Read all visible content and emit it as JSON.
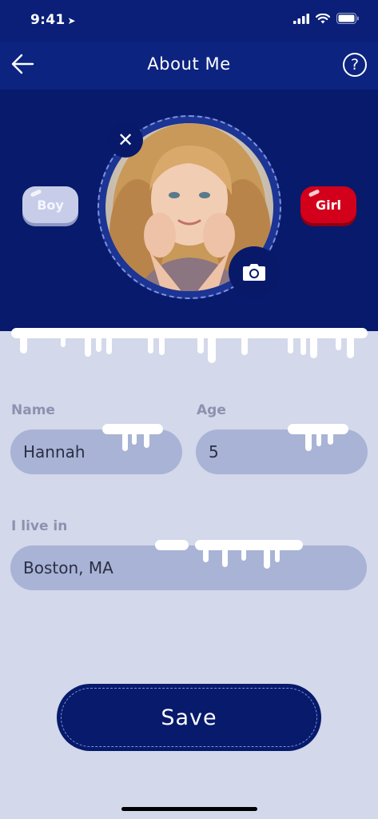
{
  "status_bar": {
    "time": "9:41"
  },
  "nav": {
    "title": "About Me",
    "help_label": "?"
  },
  "profile": {
    "boy_label": "Boy",
    "girl_label": "Girl",
    "selected_gender": "Girl"
  },
  "form": {
    "name_label": "Name",
    "name_value": "Hannah",
    "age_label": "Age",
    "age_value": "5",
    "location_label": "I live in",
    "location_value": "Boston, MA"
  },
  "save_label": "Save",
  "colors": {
    "header": "#0c2380",
    "hero": "#071a6b",
    "background": "#d3d8ea",
    "field": "#a8b3d6",
    "girl_selected": "#d2001b",
    "boy_unselected": "#c7cde8"
  },
  "icons": [
    "location-arrow-icon",
    "signal-icon",
    "wifi-icon",
    "battery-icon",
    "back-arrow-icon",
    "help-icon",
    "close-icon",
    "camera-icon"
  ]
}
